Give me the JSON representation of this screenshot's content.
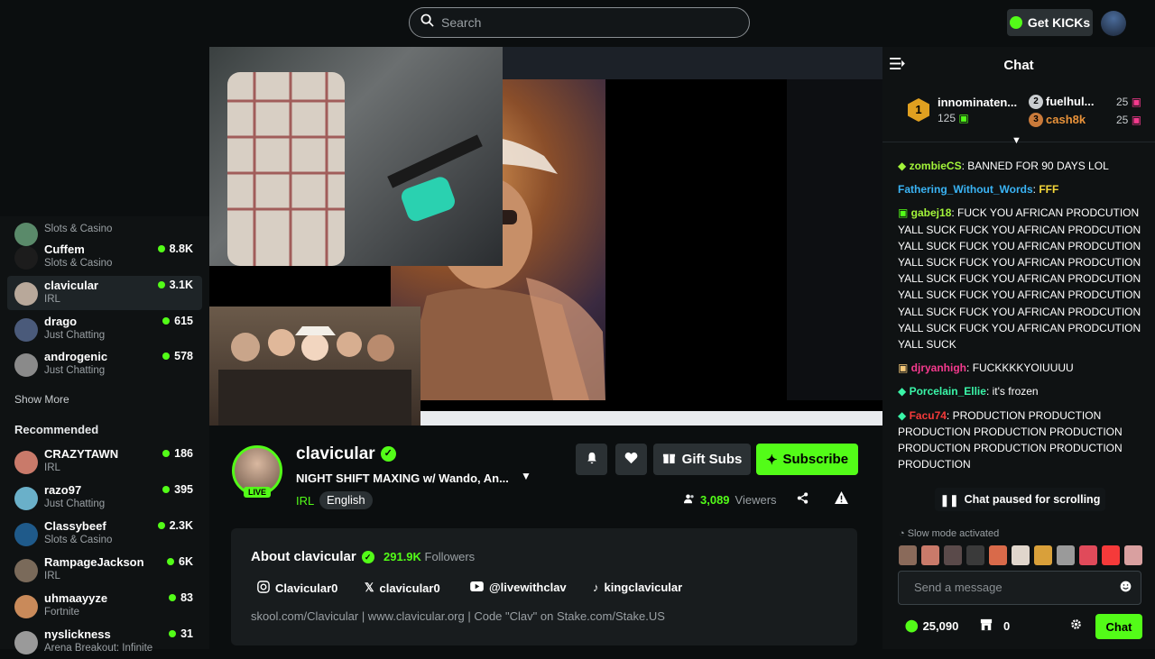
{
  "search": {
    "placeholder": "Search"
  },
  "header": {
    "get_kicks_label": "Get KICKs"
  },
  "sidebar": {
    "following": [
      {
        "name": "",
        "category": "Slots & Casino",
        "count": ""
      },
      {
        "name": "Cuffem",
        "category": "Slots & Casino",
        "count": "8.8K"
      },
      {
        "name": "clavicular",
        "category": "IRL",
        "count": "3.1K"
      },
      {
        "name": "drago",
        "category": "Just Chatting",
        "count": "615"
      },
      {
        "name": "androgenic",
        "category": "Just Chatting",
        "count": "578"
      }
    ],
    "show_more": "Show More",
    "recommended_heading": "Recommended",
    "recommended": [
      {
        "name": "CRAZYTAWN",
        "category": "IRL",
        "count": "186"
      },
      {
        "name": "razo97",
        "category": "Just Chatting",
        "count": "395"
      },
      {
        "name": "Classybeef",
        "category": "Slots & Casino",
        "count": "2.3K"
      },
      {
        "name": "RampageJackson",
        "category": "IRL",
        "count": "6K"
      },
      {
        "name": "uhmaayyze",
        "category": "Fortnite",
        "count": "83"
      },
      {
        "name": "nyslickness",
        "category": "Arena Breakout: Infinite",
        "count": "31"
      }
    ]
  },
  "stream": {
    "name": "clavicular",
    "title": "NIGHT SHIFT MAXING w/ Wando, An...",
    "category": "IRL",
    "language": "English",
    "live_badge": "LIVE",
    "viewers_count": "3,089",
    "viewers_label": "Viewers",
    "gift_subs_label": "Gift Subs",
    "subscribe_label": "Subscribe"
  },
  "about": {
    "title": "About clavicular",
    "followers_count": "291.9K",
    "followers_label": "Followers",
    "socials": {
      "instagram": "Clavicular0",
      "x": "clavicular0",
      "youtube": "@livewithclav",
      "tiktok": "kingclavicular"
    },
    "links": "skool.com/Clavicular | www.clavicular.org | Code \"Clav\" on Stake.com/Stake.US"
  },
  "chat": {
    "title": "Chat",
    "leaderboard": [
      {
        "rank": "1",
        "name": "innominaten...",
        "value": "125"
      },
      {
        "rank": "2",
        "name": "fuelhul...",
        "value": "25"
      },
      {
        "rank": "3",
        "name": "cash8k",
        "value": "25"
      }
    ],
    "messages": [
      {
        "user": "zombieCS",
        "color": "#a3f53a",
        "text": "BANNED FOR 90 DAYS LOL"
      },
      {
        "user": "Fathering_Without_Words",
        "color": "#3ab4f5",
        "text": "FFF"
      },
      {
        "user": "gabej18",
        "color": "#a3f53a",
        "text": "FUCK YOU AFRICAN PRODCUTION YALL SUCK FUCK YOU AFRICAN PRODCUTION YALL SUCK FUCK YOU AFRICAN PRODCUTION YALL SUCK FUCK YOU AFRICAN PRODCUTION YALL SUCK FUCK YOU AFRICAN PRODCUTION YALL SUCK FUCK YOU AFRICAN PRODCUTION YALL SUCK FUCK YOU AFRICAN PRODCUTION YALL SUCK FUCK YOU AFRICAN PRODCUTION YALL SUCK"
      },
      {
        "user": "djryanhigh",
        "color": "#f53a8e",
        "text": "FUCKKKKYOIUUUU"
      },
      {
        "user": "Porcelain_Ellie",
        "color": "#3af5a8",
        "text": "it's frozen"
      },
      {
        "user": "Facu74",
        "color": "#f53a3a",
        "text": "PRODUCTION PRODUCTION PRODUCTION PRODUCTION PRODUCTION PRODUCTION PRODUCTION PRODUCTION PRODUCTION"
      }
    ],
    "paused_label": "Chat paused for scrolling",
    "slow_mode": "Slow mode activated",
    "input_placeholder": "Send a message",
    "points": "25,090",
    "shop_count": "0",
    "chat_button": "Chat"
  },
  "colors": {
    "accent": "#53fc18",
    "background": "#0b0e0f",
    "panel": "#181c1e"
  }
}
